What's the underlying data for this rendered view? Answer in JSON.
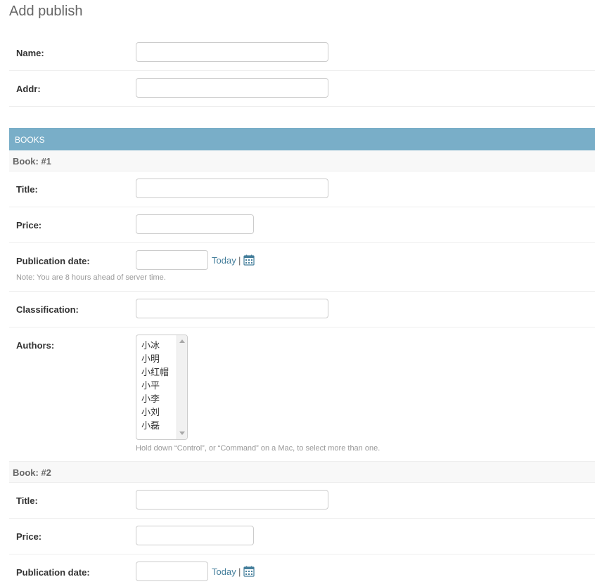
{
  "page": {
    "title": "Add publish"
  },
  "main_fields": {
    "name_label": "Name:",
    "name_value": "",
    "addr_label": "Addr:",
    "addr_value": ""
  },
  "section": {
    "title": "BOOKS"
  },
  "books": [
    {
      "header": "Book: #1",
      "title_label": "Title:",
      "title_value": "",
      "price_label": "Price:",
      "price_value": "",
      "pubdate_label": "Publication date:",
      "pubdate_value": "",
      "today_link": "Today",
      "separator": "|",
      "timezone_note": "Note: You are 8 hours ahead of server time.",
      "classification_label": "Classification:",
      "classification_value": "",
      "authors_label": "Authors:",
      "authors_options": [
        "小冰",
        "小明",
        "小红帽",
        "小平",
        "小李",
        "小刘",
        "小磊"
      ],
      "authors_help": "Hold down “Control”, or “Command” on a Mac, to select more than one."
    },
    {
      "header": "Book: #2",
      "title_label": "Title:",
      "title_value": "",
      "price_label": "Price:",
      "price_value": "",
      "pubdate_label": "Publication date:",
      "pubdate_value": "",
      "today_link": "Today",
      "separator": "|"
    }
  ],
  "icons": {
    "calendar": "calendar-icon"
  },
  "colors": {
    "section_bar": "#79aec8",
    "link": "#447e9b",
    "inline_header_bg": "#f8f8f8"
  }
}
